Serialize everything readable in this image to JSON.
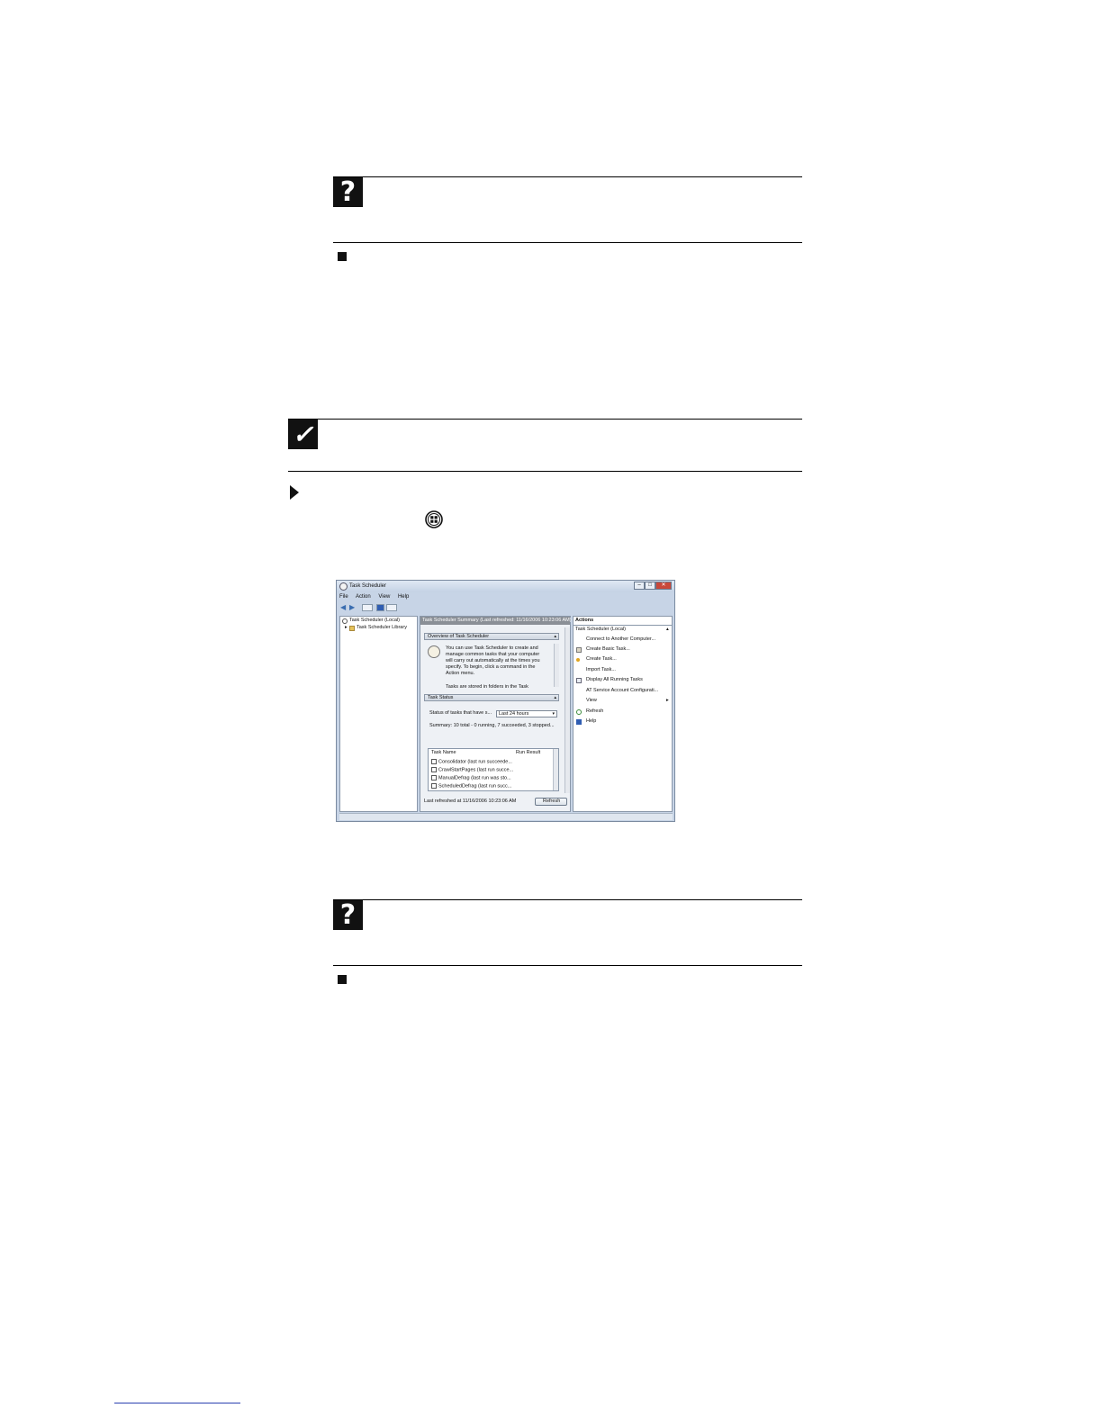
{
  "doc_icons": {
    "help_icon_glyph": "?",
    "note_icon_glyph": "✓",
    "procedure_icon": "triangle-right-icon",
    "end_icon": "square-icon",
    "windows_start_icon": "windows-start-button-icon"
  },
  "window": {
    "title": "Task Scheduler",
    "controls": {
      "minimize": "–",
      "maximize": "□",
      "close": "✕"
    },
    "menu": [
      "File",
      "Action",
      "View",
      "Help"
    ],
    "tree": {
      "root": "Task Scheduler (Local)",
      "child": "Task Scheduler Library"
    },
    "summary": {
      "header": "Task Scheduler Summary (Last refreshed: 11/16/2006 10:23:06 AM)",
      "overview_title": "Overview of Task Scheduler",
      "overview_text": [
        "You can use Task Scheduler to create and",
        "manage common tasks that your computer",
        "will carry out automatically at the times you",
        "specify. To begin, click a command in the",
        "Action menu.",
        "",
        "Tasks are stored in folders in the Task"
      ],
      "status_title": "Task Status",
      "status_label": "Status of tasks that have s...",
      "status_select": "Last 24 hours",
      "summary_line": "Summary: 10 total - 0 running, 7 succeeded, 3 stopped...",
      "table_headers": [
        "Task Name",
        "Run Result"
      ],
      "tasks": [
        "Consolidator (last run succeede...",
        "CrawlStartPages (last run succe...",
        "ManualDefrag (last run was sto...",
        "ScheduledDefrag (last run succ..."
      ],
      "last_refreshed": "Last refreshed at 11/16/2006 10:23:06 AM",
      "refresh_button": "Refresh"
    },
    "actions": {
      "header": "Actions",
      "group": "Task Scheduler (Local)",
      "items": [
        "Connect to Another Computer...",
        "Create Basic Task...",
        "Create Task...",
        "Import Task...",
        "Display All Running Tasks",
        "AT Service Account Configurati...",
        "View",
        "Refresh",
        "Help"
      ]
    }
  }
}
